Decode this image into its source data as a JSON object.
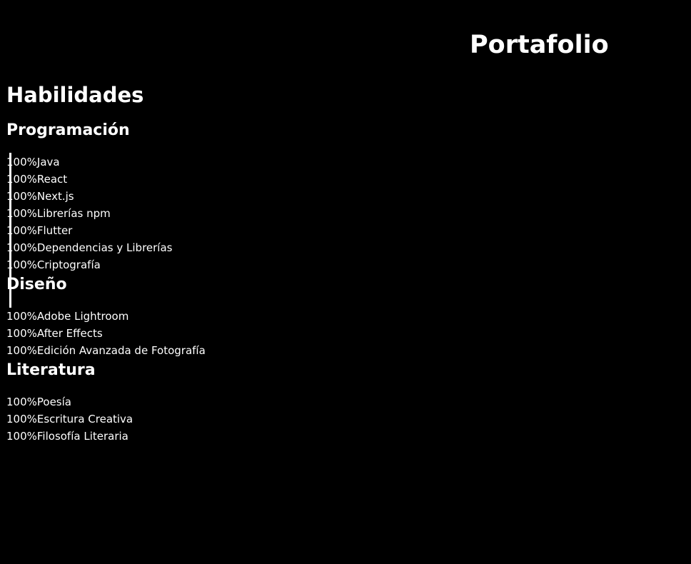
{
  "header": {
    "title": "Portafolio"
  },
  "skills": {
    "heading": "Habilidades",
    "categories": [
      {
        "title": "Programación",
        "items": [
          {
            "percent": "100%",
            "label": "Java"
          },
          {
            "percent": "100%",
            "label": "React"
          },
          {
            "percent": "100%",
            "label": "Next.js"
          },
          {
            "percent": "100%",
            "label": "Librerías npm"
          },
          {
            "percent": "100%",
            "label": "Flutter"
          },
          {
            "percent": "100%",
            "label": "Dependencias y Librerías"
          },
          {
            "percent": "100%",
            "label": "Criptografía"
          }
        ]
      },
      {
        "title": "Diseño",
        "items": [
          {
            "percent": "100%",
            "label": "Adobe Lightroom"
          },
          {
            "percent": "100%",
            "label": "After Effects"
          },
          {
            "percent": "100%",
            "label": "Edición Avanzada de Fotografía"
          }
        ]
      },
      {
        "title": "Literatura",
        "items": [
          {
            "percent": "100%",
            "label": "Poesía"
          },
          {
            "percent": "100%",
            "label": "Escritura Creativa"
          },
          {
            "percent": "100%",
            "label": "Filosofía Literaria"
          }
        ]
      }
    ]
  },
  "colors": {
    "background": "#000000",
    "text": "#ffffff"
  }
}
